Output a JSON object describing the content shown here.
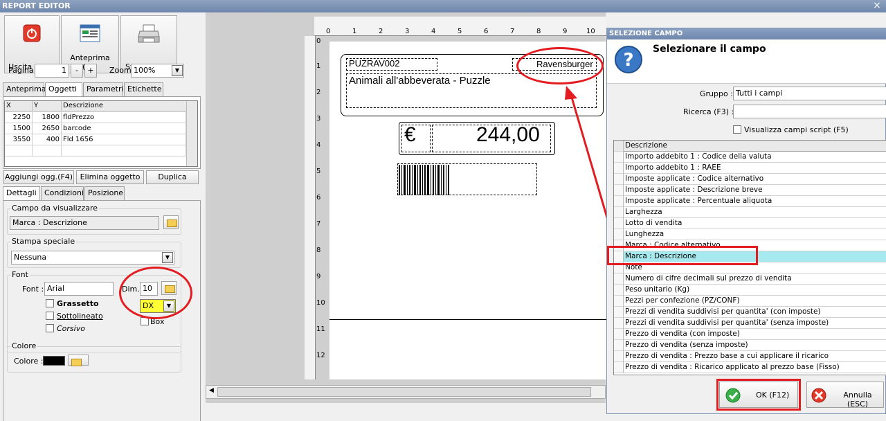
{
  "window": {
    "title": "REPORT EDITOR",
    "close_label": "×"
  },
  "toolbar": {
    "exit_label": "Uscita (ESC)",
    "preview_label": "Anteprima (F3)",
    "print_label": "Stampa (F9)",
    "page_label": "Pagina",
    "page_value": "1",
    "page_minus": "-",
    "page_plus": "+",
    "zoom_label": "Zoom",
    "zoom_value": "100%"
  },
  "tabs_top": [
    "Anteprima",
    "Oggetti",
    "Parametri",
    "Etichette"
  ],
  "objects_grid": {
    "headers": [
      "X",
      "Y",
      "Descrizione"
    ],
    "rows": [
      {
        "x": "2250",
        "y": "1800",
        "desc": "fldPrezzo"
      },
      {
        "x": "1500",
        "y": "2650",
        "desc": "barcode"
      },
      {
        "x": "3550",
        "y": "400",
        "desc": "Fld 1656"
      }
    ]
  },
  "object_actions": {
    "add": "Aggiungi ogg.(F4)",
    "delete": "Elimina oggetto",
    "duplicate": "Duplica"
  },
  "tabs_bottom": [
    "Dettagli",
    "Condizioni",
    "Posizione"
  ],
  "details": {
    "field_group": "Campo da visualizzare",
    "field_value": "Marca : Descrizione",
    "special_group": "Stampa speciale",
    "special_value": "Nessuna",
    "font_group": "Font",
    "font_label": "Font :",
    "font_value": "Arial",
    "size_label": "Dim.",
    "size_value": "10",
    "bold_label": "Grassetto",
    "underline_label": "Sottolineato",
    "italic_label": "Corsivo",
    "align_value": "DX",
    "box_label": "Box",
    "color_group": "Colore",
    "color_label": "Colore :",
    "color_value": "#000000"
  },
  "ruler": {
    "h": [
      "0",
      "1",
      "2",
      "3",
      "4",
      "5",
      "6",
      "7",
      "8",
      "9",
      "10"
    ],
    "v": [
      "0",
      "1",
      "2",
      "3",
      "4",
      "5",
      "6",
      "7",
      "8",
      "9",
      "10",
      "11",
      "12"
    ]
  },
  "label": {
    "code": "PUZRAV002",
    "brand": "Ravensburger",
    "description": "Animali all'abbeverata - Puzzle",
    "currency": "€",
    "price": "244,00"
  },
  "dialog": {
    "title": "SELEZIONE CAMPO",
    "heading": "Selezionare il campo",
    "group_label": "Gruppo :",
    "group_value": "Tutti i campi",
    "search_label": "Ricerca (F3) :",
    "search_value": "",
    "script_label": "Visualizza campi script (F5)",
    "list_header": "Descrizione",
    "items": [
      "Importo addebito 1 : Codice della valuta",
      "Importo addebito 1 : RAEE",
      "Imposte applicate : Codice alternativo",
      "Imposte applicate : Descrizione breve",
      "Imposte applicate : Percentuale aliquota",
      "Larghezza",
      "Lotto di vendita",
      "Lunghezza",
      "Marca : Codice alternativo",
      "Marca : Descrizione",
      "Note",
      "Numero di cifre decimali sul prezzo di vendita",
      "Peso unitario (Kg)",
      "Pezzi per confezione (PZ/CONF)",
      "Prezzi di vendita suddivisi per quantita' (con imposte)",
      "Prezzi di vendita suddivisi per quantita' (senza imposte)",
      "Prezzo di vendita (con imposte)",
      "Prezzo di vendita (senza imposte)",
      "Prezzo di vendita : Prezzo base a cui applicare il ricarico",
      "Prezzo di vendita : Ricarico applicato al prezzo base (Fisso)"
    ],
    "selected_index": 9,
    "ok_label": "OK (F12)",
    "cancel_label": "Annulla (ESC)"
  },
  "colors": {
    "selection": "#a6e9ee",
    "highlight_red": "#e21c21",
    "dx_yellow": "#ffff33"
  }
}
